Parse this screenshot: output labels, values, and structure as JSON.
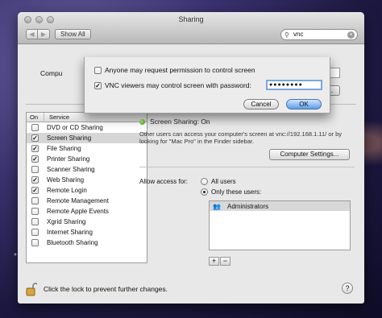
{
  "window": {
    "title": "Sharing",
    "show_all_label": "Show All",
    "search_value": "vnc",
    "back_label": "◀",
    "forward_label": "▶"
  },
  "computer": {
    "name_label": "Compu",
    "edit_label": "Edit..."
  },
  "services": {
    "col_on": "On",
    "col_service": "Service",
    "items": [
      {
        "label": "DVD or CD Sharing",
        "on": false
      },
      {
        "label": "Screen Sharing",
        "on": true
      },
      {
        "label": "File Sharing",
        "on": true
      },
      {
        "label": "Printer Sharing",
        "on": true
      },
      {
        "label": "Scanner Sharing",
        "on": false
      },
      {
        "label": "Web Sharing",
        "on": true
      },
      {
        "label": "Remote Login",
        "on": true
      },
      {
        "label": "Remote Management",
        "on": false
      },
      {
        "label": "Remote Apple Events",
        "on": false
      },
      {
        "label": "Xgrid Sharing",
        "on": false
      },
      {
        "label": "Internet Sharing",
        "on": false
      },
      {
        "label": "Bluetooth Sharing",
        "on": false
      }
    ],
    "selected_index": 1
  },
  "detail": {
    "status": "Screen Sharing: On",
    "info": "Other users can access your computer's screen at vnc://192.168.1.11/ or by looking for \"Mac Pro\" in the Finder sidebar.",
    "computer_settings_label": "Computer Settings...",
    "allow_label": "Allow access for:",
    "all_users_label": "All users",
    "only_users_label": "Only these users:",
    "users": [
      "Administrators"
    ],
    "add_label": "+",
    "remove_label": "−"
  },
  "bottom": {
    "lock_text": "Click the lock to prevent further changes.",
    "help_label": "?"
  },
  "sheet": {
    "request_permission_label": "Anyone may request permission to control screen",
    "request_permission_checked": false,
    "vnc_label": "VNC viewers may control screen with password:",
    "vnc_checked": true,
    "password_value": "●●●●●●●●",
    "cancel_label": "Cancel",
    "ok_label": "OK"
  }
}
